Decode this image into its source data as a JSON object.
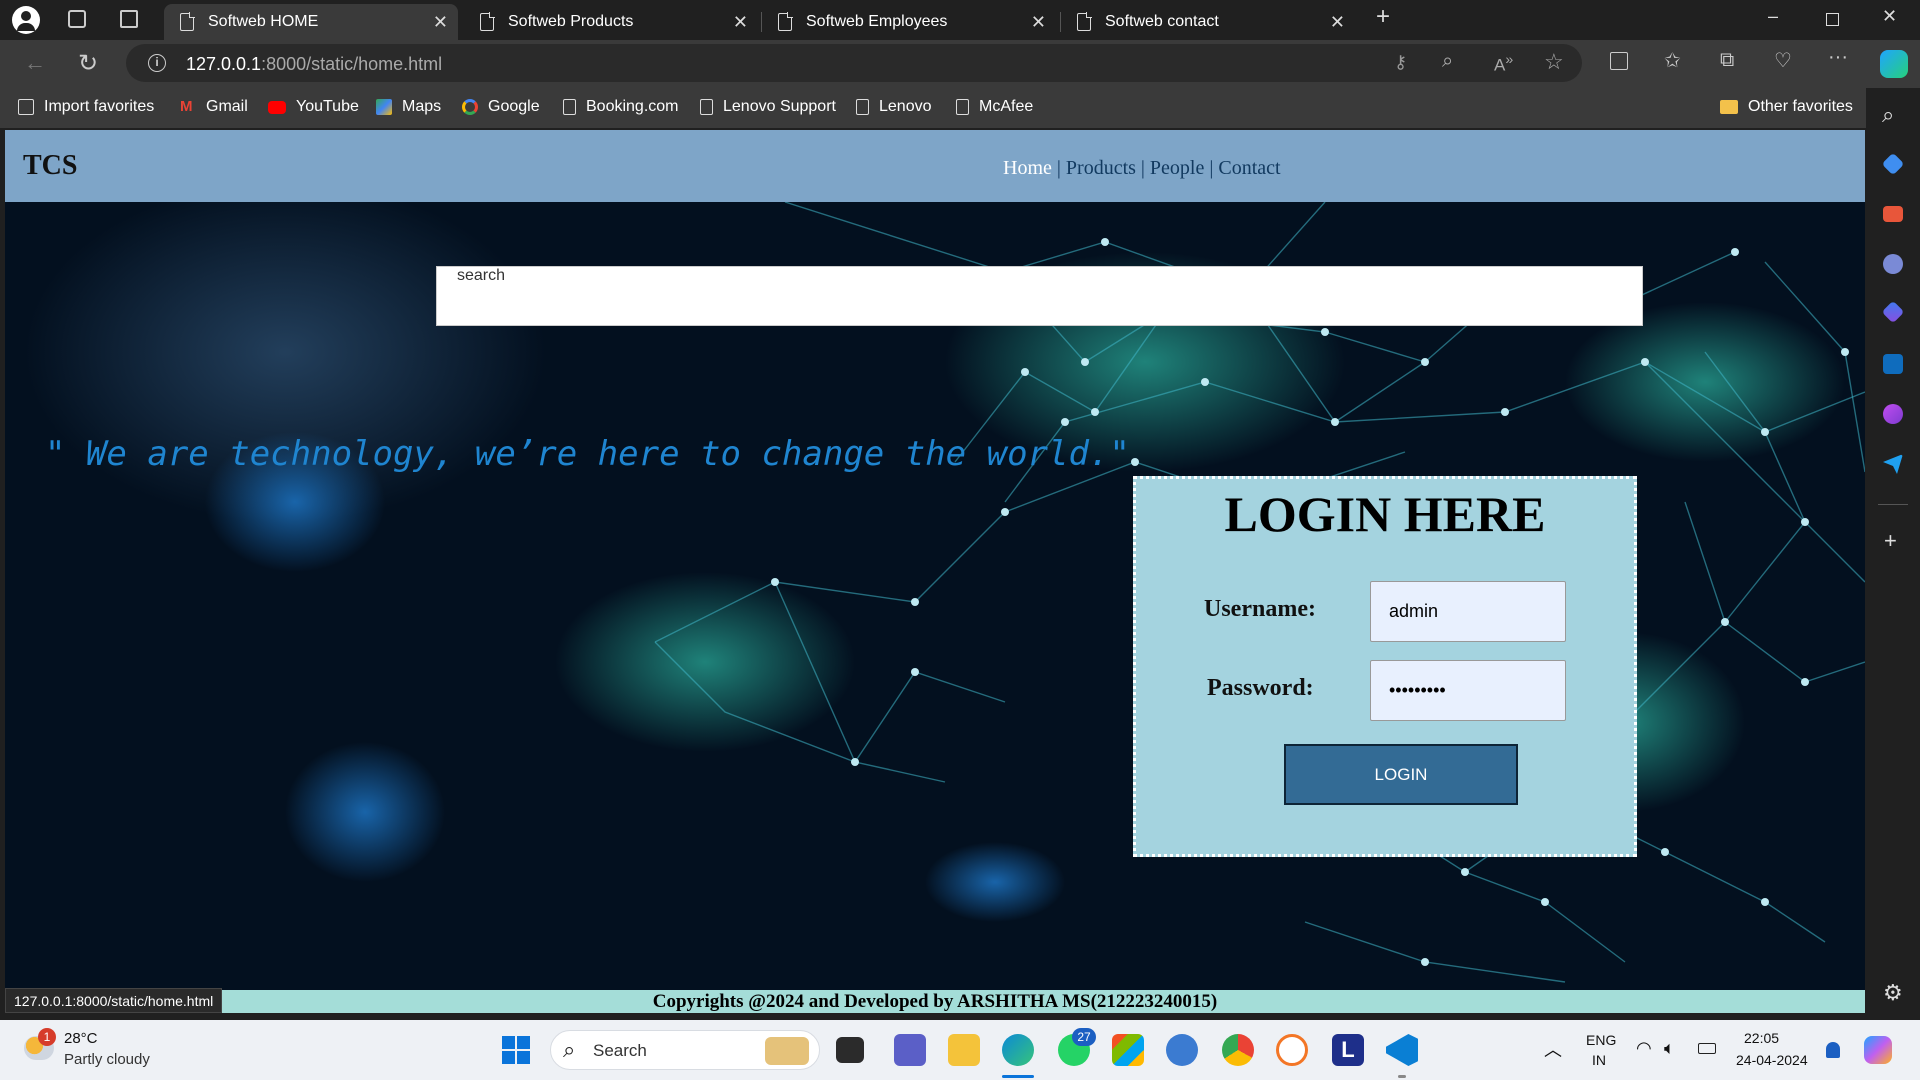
{
  "browser": {
    "tabs": [
      {
        "label": "Softweb HOME",
        "active": true
      },
      {
        "label": "Softweb Products",
        "active": false
      },
      {
        "label": "Softweb Employees",
        "active": false
      },
      {
        "label": "Softweb contact",
        "active": false
      }
    ],
    "url_host": "127.0.0.1",
    "url_rest": ":8000/static/home.html",
    "bookmarks": [
      "Import favorites",
      "Gmail",
      "YouTube",
      "Maps",
      "Google",
      "Booking.com",
      "Lenovo Support",
      "Lenovo",
      "McAfee"
    ],
    "other_favorites": "Other favorites",
    "status_url": "127.0.0.1:8000/static/home.html"
  },
  "page": {
    "brand": "TCS",
    "nav": {
      "home": "Home",
      "products": "Products",
      "people": "People",
      "contact": "Contact",
      "sep": "|"
    },
    "search_placeholder": "search",
    "quote": "\" We are technology, we’re here to change the world.\"",
    "login": {
      "title": "LOGIN HERE",
      "username_label": "Username:",
      "username_value": "admin",
      "password_label": "Password:",
      "password_value": "•••••••••",
      "button": "LOGIN"
    },
    "footer": "Copyrights @2024 and Developed by ARSHITHA MS(212223240015)"
  },
  "taskbar": {
    "weather_temp": "28°C",
    "weather_desc": "Partly cloudy",
    "weather_badge": "1",
    "search": "Search",
    "whatsapp_badge": "27",
    "lang_1": "ENG",
    "lang_2": "IN",
    "time": "22:05",
    "date": "24-04-2024"
  },
  "colors": {
    "navbar": "#7ea5c8",
    "login_panel": "#a4d3df",
    "login_button": "#336b95",
    "quote": "#1f85d0",
    "footer": "#a4ddd8"
  }
}
